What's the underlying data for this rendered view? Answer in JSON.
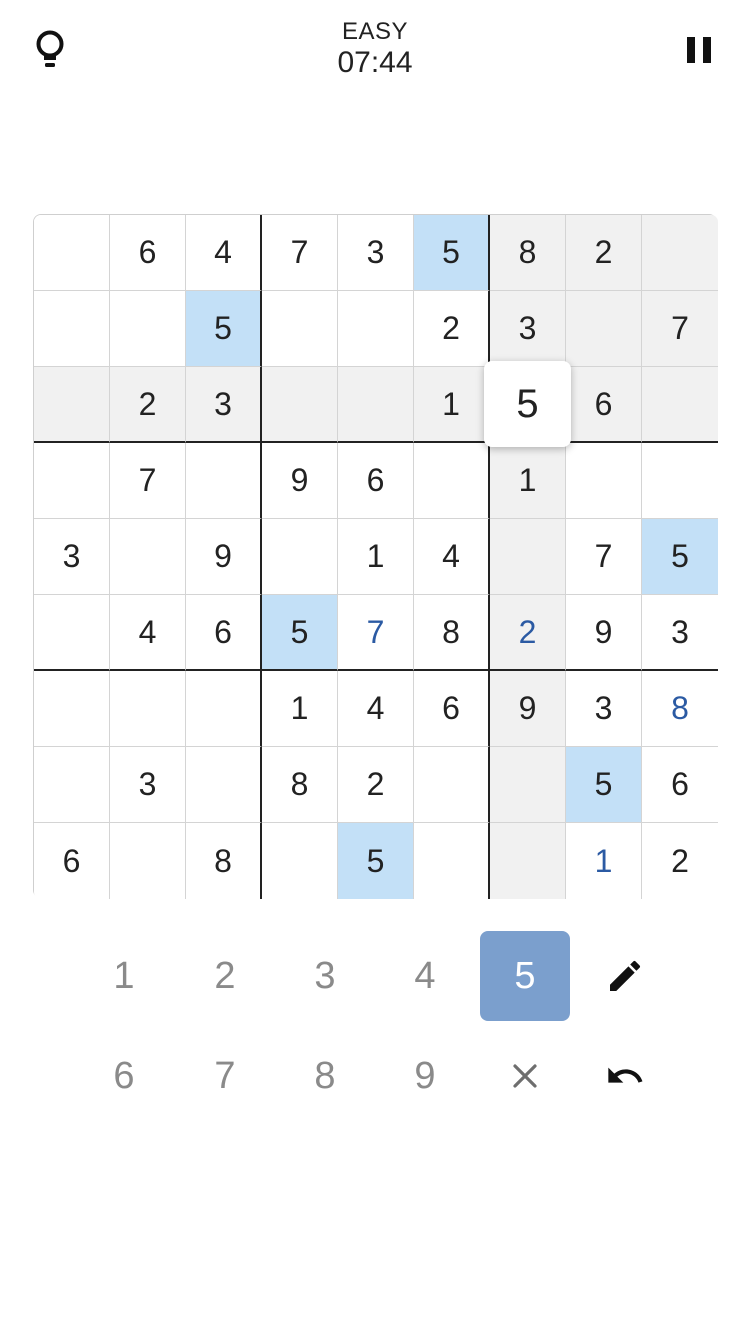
{
  "header": {
    "difficulty": "EASY",
    "timer": "07:44",
    "hint_icon": "lightbulb-icon",
    "pause_icon": "pause-icon"
  },
  "board": {
    "selected": {
      "row": 2,
      "col": 6
    },
    "highlight_value": "5",
    "cells": [
      [
        "",
        "6",
        "4",
        "7",
        "3",
        "5",
        "8",
        "2",
        ""
      ],
      [
        "",
        "",
        "5",
        "",
        "",
        "2",
        "3",
        "",
        "7"
      ],
      [
        "",
        "2",
        "3",
        "",
        "",
        "1",
        "5",
        "6",
        ""
      ],
      [
        "",
        "7",
        "",
        "9",
        "6",
        "",
        "1",
        "",
        ""
      ],
      [
        "3",
        "",
        "9",
        "",
        "1",
        "4",
        "",
        "7",
        "5"
      ],
      [
        "",
        "4",
        "6",
        "5",
        "7",
        "8",
        "2",
        "9",
        "3"
      ],
      [
        "",
        "",
        "",
        "1",
        "4",
        "6",
        "9",
        "3",
        "8"
      ],
      [
        "",
        "3",
        "",
        "8",
        "2",
        "",
        "",
        "5",
        "6"
      ],
      [
        "6",
        "",
        "8",
        "",
        "5",
        "",
        "",
        "1",
        "2"
      ]
    ],
    "user_entries": [
      [
        5,
        4
      ],
      [
        5,
        6
      ],
      [
        6,
        8
      ],
      [
        8,
        7
      ]
    ]
  },
  "keypad": {
    "digits": [
      "1",
      "2",
      "3",
      "4",
      "5",
      "6",
      "7",
      "8",
      "9"
    ],
    "active_digit": "5",
    "notes_icon": "pencil-icon",
    "erase_icon": "close-icon",
    "undo_icon": "undo-icon"
  },
  "colors": {
    "match_highlight": "#c3e0f7",
    "related_highlight": "#f1f1f1",
    "active_key": "#7b9fcd",
    "user_digit": "#2b5aa3"
  }
}
